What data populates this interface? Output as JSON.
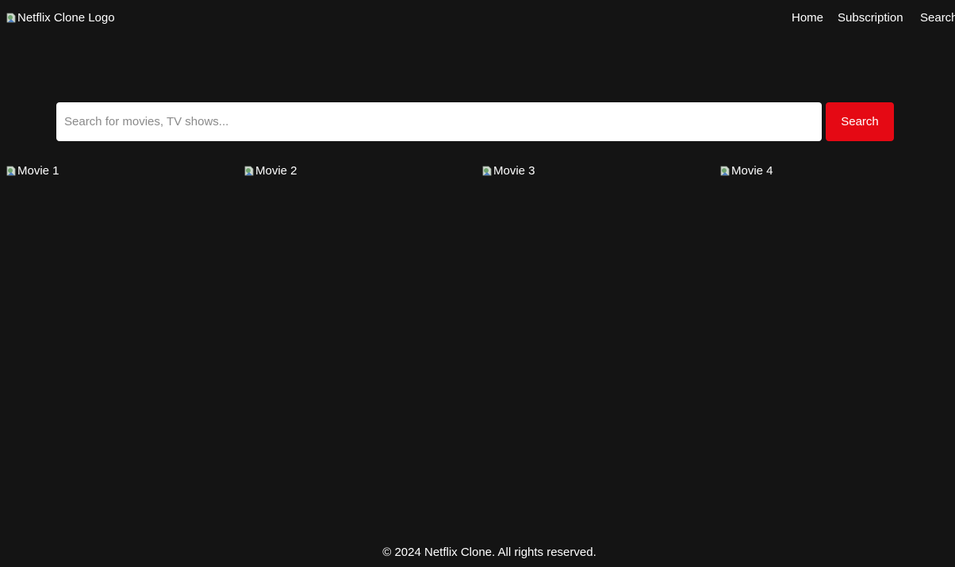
{
  "header": {
    "logo_alt": "Netflix Clone Logo",
    "nav": {
      "home": "Home",
      "subscription": "Subscription",
      "search": "Search"
    }
  },
  "search": {
    "placeholder": "Search for movies, TV shows...",
    "value": "",
    "button_label": "Search"
  },
  "movies": [
    {
      "alt": "Movie 1"
    },
    {
      "alt": "Movie 2"
    },
    {
      "alt": "Movie 3"
    },
    {
      "alt": "Movie 4"
    }
  ],
  "footer": {
    "text": "© 2024 Netflix Clone. All rights reserved."
  },
  "colors": {
    "background": "#141414",
    "accent": "#e50914",
    "text": "#ffffff"
  },
  "icons": {
    "broken_image": "broken-image-icon"
  }
}
